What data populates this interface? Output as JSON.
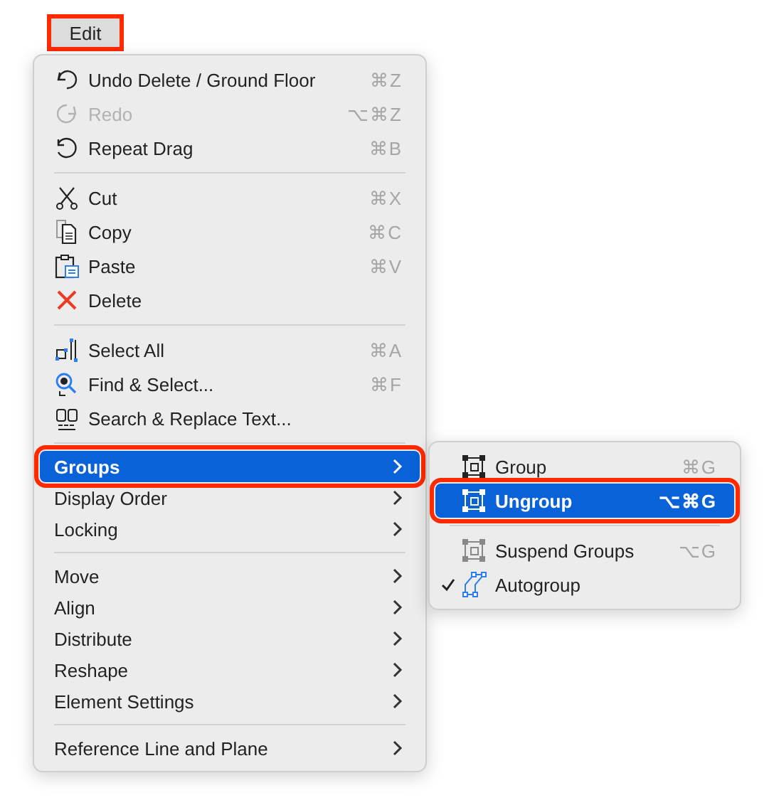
{
  "menu_button": {
    "label": "Edit",
    "annotated": true
  },
  "menu": {
    "sections": [
      [
        {
          "label": "Undo Delete / Ground Floor",
          "shortcut": "⌘Z",
          "disabled": false
        },
        {
          "label": "Redo",
          "shortcut": "⌥⌘Z",
          "disabled": true
        },
        {
          "label": "Repeat Drag",
          "shortcut": "⌘B",
          "disabled": false
        }
      ],
      [
        {
          "label": "Cut",
          "shortcut": "⌘X",
          "disabled": false
        },
        {
          "label": "Copy",
          "shortcut": "⌘C",
          "disabled": false
        },
        {
          "label": "Paste",
          "shortcut": "⌘V",
          "disabled": false
        },
        {
          "label": "Delete",
          "disabled": false
        }
      ],
      [
        {
          "label": "Select All",
          "shortcut": "⌘A",
          "disabled": false
        },
        {
          "label": "Find & Select...",
          "shortcut": "⌘F",
          "disabled": false
        },
        {
          "label": "Search & Replace Text...",
          "disabled": false
        }
      ],
      [
        {
          "label": "Groups",
          "submenu": true,
          "selected": true,
          "annotated": true
        },
        {
          "label": "Display Order",
          "submenu": true,
          "selected": false,
          "annotated": false
        },
        {
          "label": "Locking",
          "submenu": true,
          "selected": false,
          "annotated": false
        }
      ],
      [
        {
          "label": "Move",
          "submenu": true,
          "selected": false,
          "annotated": false
        },
        {
          "label": "Align",
          "submenu": true,
          "selected": false,
          "annotated": false
        },
        {
          "label": "Distribute",
          "submenu": true,
          "selected": false,
          "annotated": false
        },
        {
          "label": "Reshape",
          "submenu": true,
          "selected": false,
          "annotated": false
        },
        {
          "label": "Element Settings",
          "submenu": true,
          "selected": false,
          "annotated": false
        }
      ],
      [
        {
          "label": "Reference Line and Plane",
          "submenu": true,
          "selected": false,
          "annotated": false
        }
      ]
    ]
  },
  "submenu": {
    "sections": [
      [
        {
          "label": "Group",
          "shortcut": "⌘G",
          "selected": false,
          "annotated": false,
          "checked": false
        },
        {
          "label": "Ungroup",
          "shortcut": "⌥⌘G",
          "selected": true,
          "annotated": true,
          "checked": false
        }
      ],
      [
        {
          "label": "Suspend Groups",
          "shortcut": "⌥G",
          "selected": false,
          "annotated": false,
          "checked": false
        },
        {
          "label": "Autogroup",
          "selected": false,
          "annotated": false,
          "checked": true
        }
      ]
    ]
  }
}
